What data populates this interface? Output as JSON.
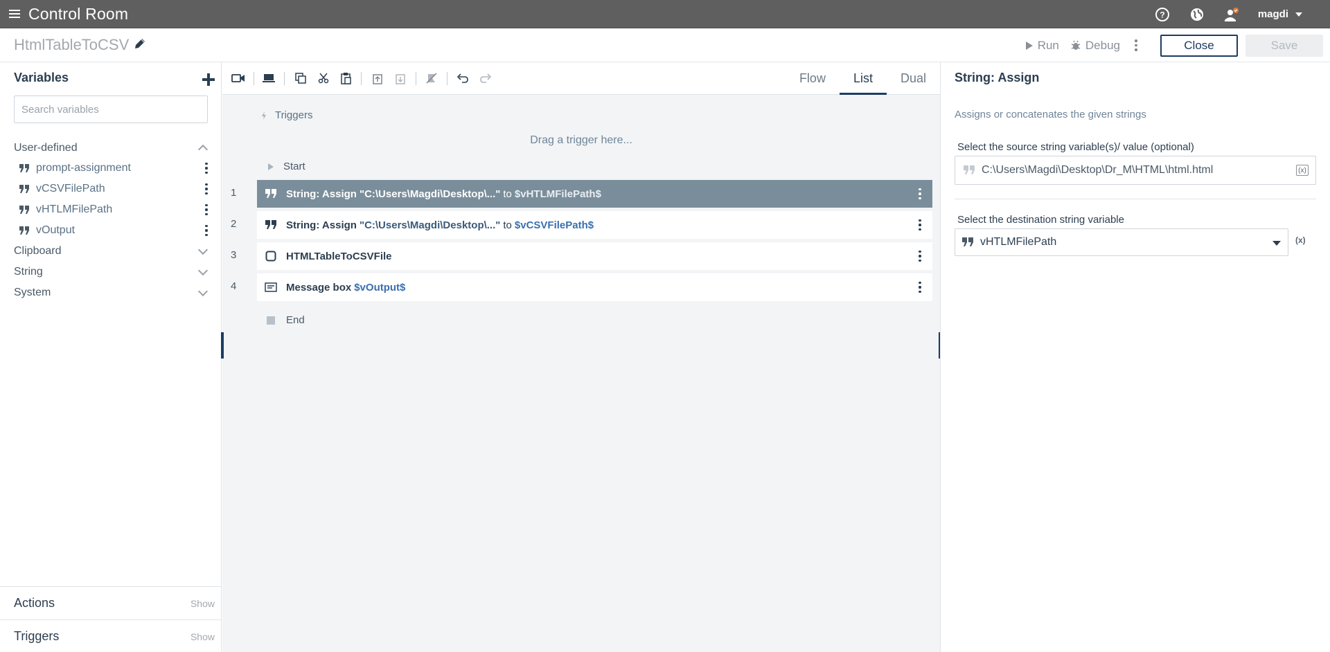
{
  "app": {
    "title": "Control Room"
  },
  "user": {
    "name": "magdi"
  },
  "bot": {
    "name": "HtmlTableToCSV"
  },
  "actions": {
    "run": "Run",
    "debug": "Debug",
    "close": "Close",
    "save": "Save"
  },
  "left": {
    "title": "Variables",
    "search_placeholder": "Search variables",
    "groups": {
      "user_defined": "User-defined",
      "clipboard": "Clipboard",
      "string": "String",
      "system": "System"
    },
    "variables": [
      "prompt-assignment",
      "vCSVFilePath",
      "vHTLMFilePath",
      "vOutput"
    ],
    "footer": [
      {
        "label": "Actions",
        "toggle": "Show"
      },
      {
        "label": "Triggers",
        "toggle": "Show"
      }
    ]
  },
  "center": {
    "view_tabs": [
      "Flow",
      "List",
      "Dual"
    ],
    "active_tab": "List",
    "triggers_label": "Triggers",
    "drop_hint": "Drag a trigger here...",
    "start_label": "Start",
    "end_label": "End",
    "steps": [
      {
        "num": "1",
        "action": "String: Assign",
        "literal": "\"C:\\Users\\Magdi\\Desktop\\...\"",
        "to": "to",
        "var": "$vHTLMFilePath$",
        "icon": "quote-icon",
        "selected": true
      },
      {
        "num": "2",
        "action": "String: Assign",
        "literal": "\"C:\\Users\\Magdi\\Desktop\\...\"",
        "to": "to",
        "var": "$vCSVFilePath$",
        "icon": "quote-icon",
        "selected": false
      },
      {
        "num": "3",
        "action": "HTMLTableToCSVFile",
        "icon": "task-icon",
        "selected": false
      },
      {
        "num": "4",
        "action": "Message box",
        "var": "$vOutput$",
        "icon": "message-box-icon",
        "selected": false
      }
    ]
  },
  "right": {
    "title": "String: Assign",
    "description": "Assigns or concatenates the given strings",
    "source_label": "Select the source string variable(s)/ value (optional)",
    "source_value": "C:\\Users\\Magdi\\Desktop\\Dr_M\\HTML\\html.html",
    "dest_label": "Select the destination string variable",
    "dest_value": "vHTLMFilePath",
    "var_insert_glyph": "(x)"
  },
  "colors": {
    "topbar": "#5f5f5f",
    "accent": "#1d3b63",
    "selected_row": "#7a8d9a",
    "canvas": "#f2f4f6"
  }
}
